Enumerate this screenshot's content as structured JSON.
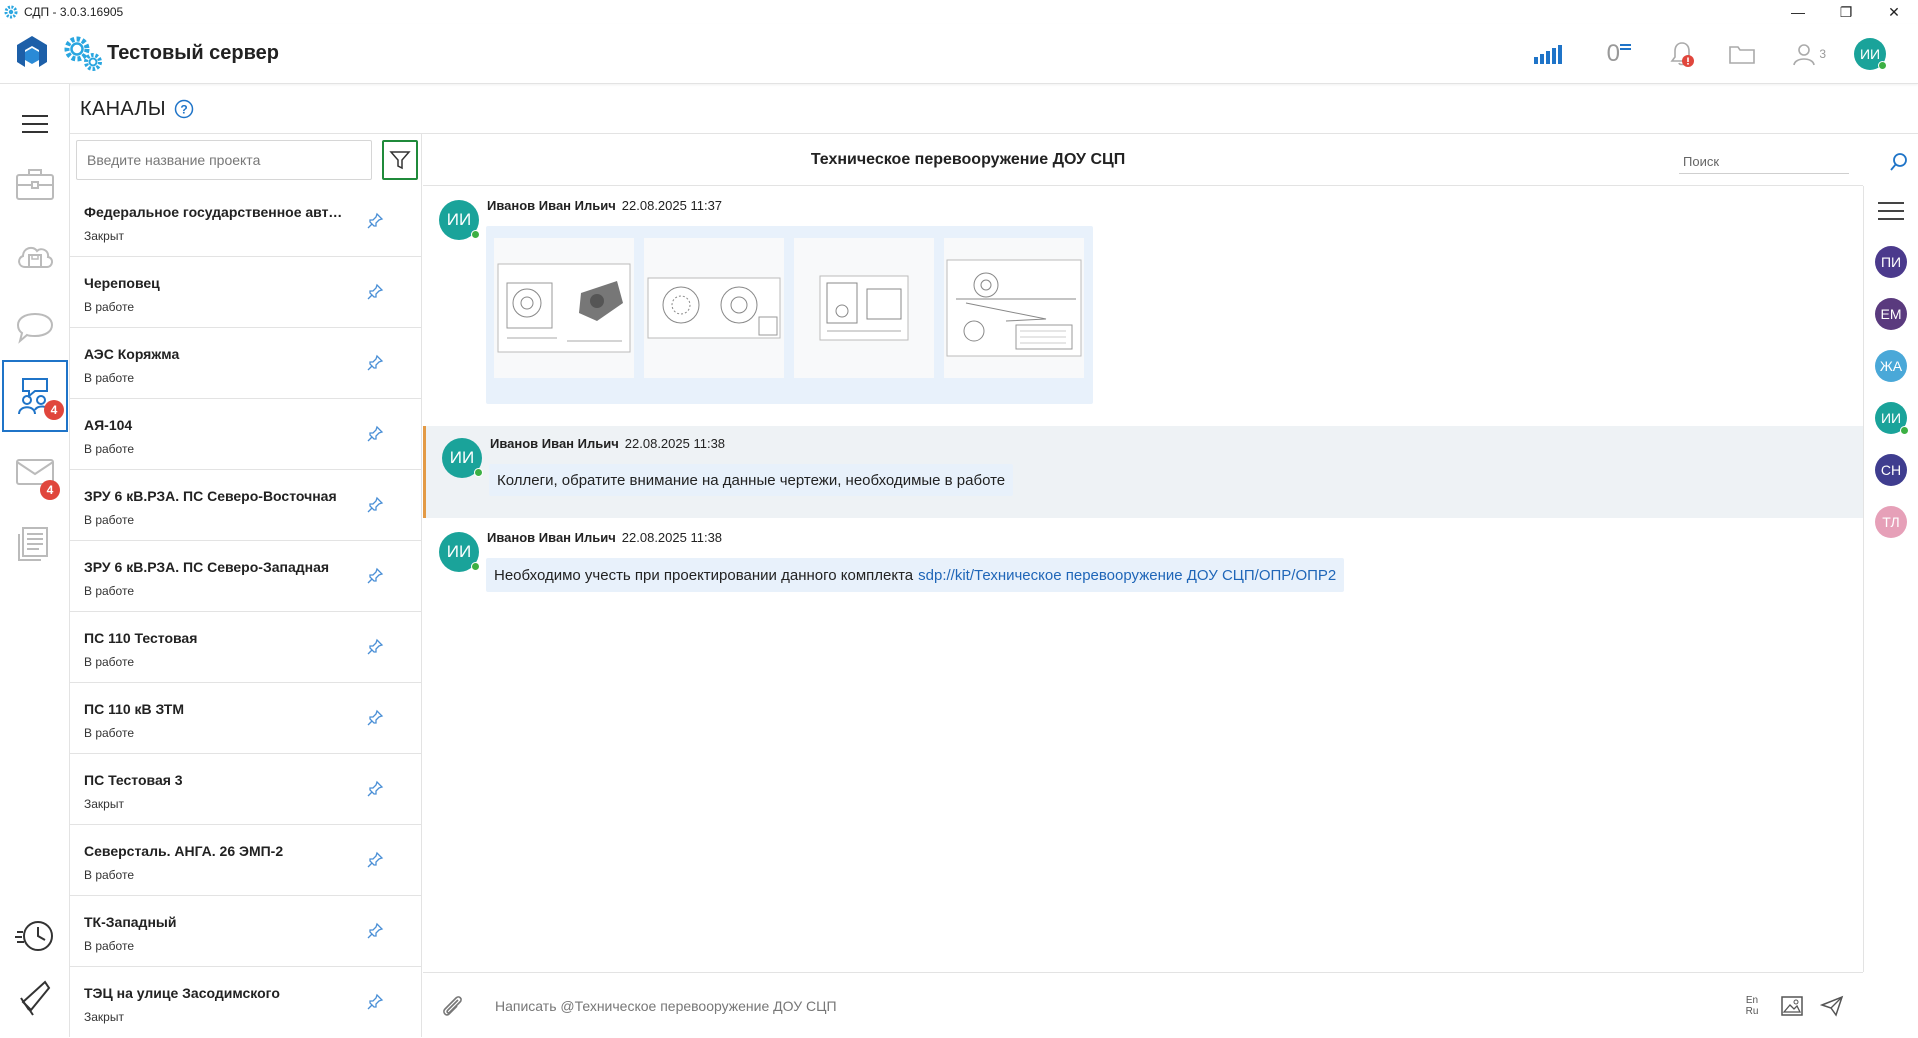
{
  "window": {
    "title": "СДП - 3.0.3.16905",
    "controls": {
      "minimize": "—",
      "restore": "❐",
      "close": "✕"
    }
  },
  "header": {
    "server_name": "Тестовый сервер",
    "counter_value": "0",
    "users_count": "3",
    "user_initials": "ИИ",
    "colors": {
      "accent": "#1f74c8",
      "avatar": "#1aa39a",
      "badge": "#e0463c"
    }
  },
  "rail": {
    "items": [
      {
        "name": "projects",
        "icon": "briefcase-icon"
      },
      {
        "name": "storage",
        "icon": "cloud-save-icon"
      },
      {
        "name": "chats",
        "icon": "chat-bubble-icon"
      },
      {
        "name": "channels",
        "icon": "people-chat-icon",
        "badge": "4",
        "active": true
      },
      {
        "name": "mail",
        "icon": "mail-icon",
        "badge": "4"
      },
      {
        "name": "documents",
        "icon": "documents-icon"
      },
      {
        "name": "history",
        "icon": "clock-icon"
      },
      {
        "name": "announcements",
        "icon": "megaphone-icon"
      }
    ]
  },
  "page": {
    "title": "КАНАЛЫ"
  },
  "channels": {
    "search_placeholder": "Введите название проекта",
    "items": [
      {
        "name": "Федеральное государственное автон...",
        "status": "Закрыт"
      },
      {
        "name": "Череповец",
        "status": "В работе"
      },
      {
        "name": "АЭС Коряжма",
        "status": "В работе"
      },
      {
        "name": "АЯ-104",
        "status": "В работе"
      },
      {
        "name": "ЗРУ 6 кВ.РЗА. ПС Северо-Восточная",
        "status": "В работе"
      },
      {
        "name": "ЗРУ 6 кВ.РЗА. ПС Северо-Западная",
        "status": "В работе"
      },
      {
        "name": "ПС 110 Тестовая",
        "status": "В работе"
      },
      {
        "name": "ПС 110 кВ ЗТМ",
        "status": "В работе"
      },
      {
        "name": "ПС Тестовая 3",
        "status": "Закрыт"
      },
      {
        "name": "Северсталь. АНГА. 26 ЭМП-2",
        "status": "В работе"
      },
      {
        "name": "ТК-Западный",
        "status": "В работе"
      },
      {
        "name": "ТЭЦ на улице Засодимского",
        "status": "Закрыт"
      }
    ]
  },
  "chat": {
    "title": "Техническое перевооружение ДОУ СЦП",
    "search_placeholder": "Поиск",
    "messages": [
      {
        "initials": "ИИ",
        "author": "Иванов Иван Ильич",
        "time": "22.08.2025 11:37",
        "type": "images",
        "image_count": 4
      },
      {
        "initials": "ИИ",
        "author": "Иванов Иван Ильич",
        "time": "22.08.2025 11:38",
        "text": "Коллеги, обратите внимание на данные чертежи, необходимые в работе",
        "highlighted": true
      },
      {
        "initials": "ИИ",
        "author": "Иванов Иван Ильич",
        "time": "22.08.2025 11:38",
        "text": "Необходимо учесть при проектировании данного комплекта",
        "link": "sdp://kit/Техническое перевооружение ДОУ СЦП/ОПР/ОПР2"
      }
    ],
    "composer_placeholder": "Написать @Техническое перевооружение ДОУ СЦП",
    "lang_toggle": "En Ru"
  },
  "members": [
    {
      "initials": "ПИ",
      "color": "#4b3a8c"
    },
    {
      "initials": "ЕМ",
      "color": "#5a3a7e"
    },
    {
      "initials": "ЖА",
      "color": "#4aa8d8"
    },
    {
      "initials": "ИИ",
      "color": "#1aa39a",
      "online": true
    },
    {
      "initials": "СН",
      "color": "#3f3d8f"
    },
    {
      "initials": "ТЛ",
      "color": "#e6a0b8"
    }
  ]
}
